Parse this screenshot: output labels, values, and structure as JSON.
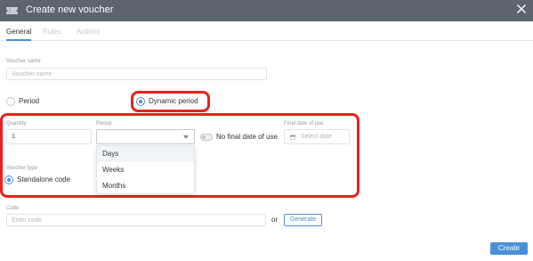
{
  "window": {
    "title": "Create new voucher",
    "icon": "ticket-icon",
    "close_icon": "close-icon"
  },
  "tabs": [
    {
      "label": "General",
      "active": true
    },
    {
      "label": "Rules",
      "active": false
    },
    {
      "label": "Actions",
      "active": false
    }
  ],
  "voucher_name": {
    "label": "Voucher name",
    "placeholder": "Voucher name",
    "value": ""
  },
  "period_mode": {
    "options": [
      {
        "label": "Period",
        "selected": false
      },
      {
        "label": "Dynamic period",
        "selected": true
      }
    ]
  },
  "quantity": {
    "label": "Quantity",
    "value": "1"
  },
  "period_select": {
    "label": "Period",
    "value": "",
    "options": [
      "Days",
      "Weeks",
      "Months"
    ],
    "hovered_option": "Days"
  },
  "final_date": {
    "label": "Final date of use",
    "toggle_label": "No final date of use",
    "toggle_on": false,
    "placeholder": "Select date",
    "icon": "calendar-icon"
  },
  "voucher_type": {
    "label": "Voucher type",
    "option": "Standalone code",
    "selected": true
  },
  "code": {
    "label": "Code",
    "placeholder": "Enter code",
    "or_text": "or",
    "generate_label": "Generate"
  },
  "actions": {
    "create_label": "Create"
  },
  "colors": {
    "titlebar": "#5c6470",
    "accent": "#4a90d9",
    "highlight": "#e8211c"
  }
}
